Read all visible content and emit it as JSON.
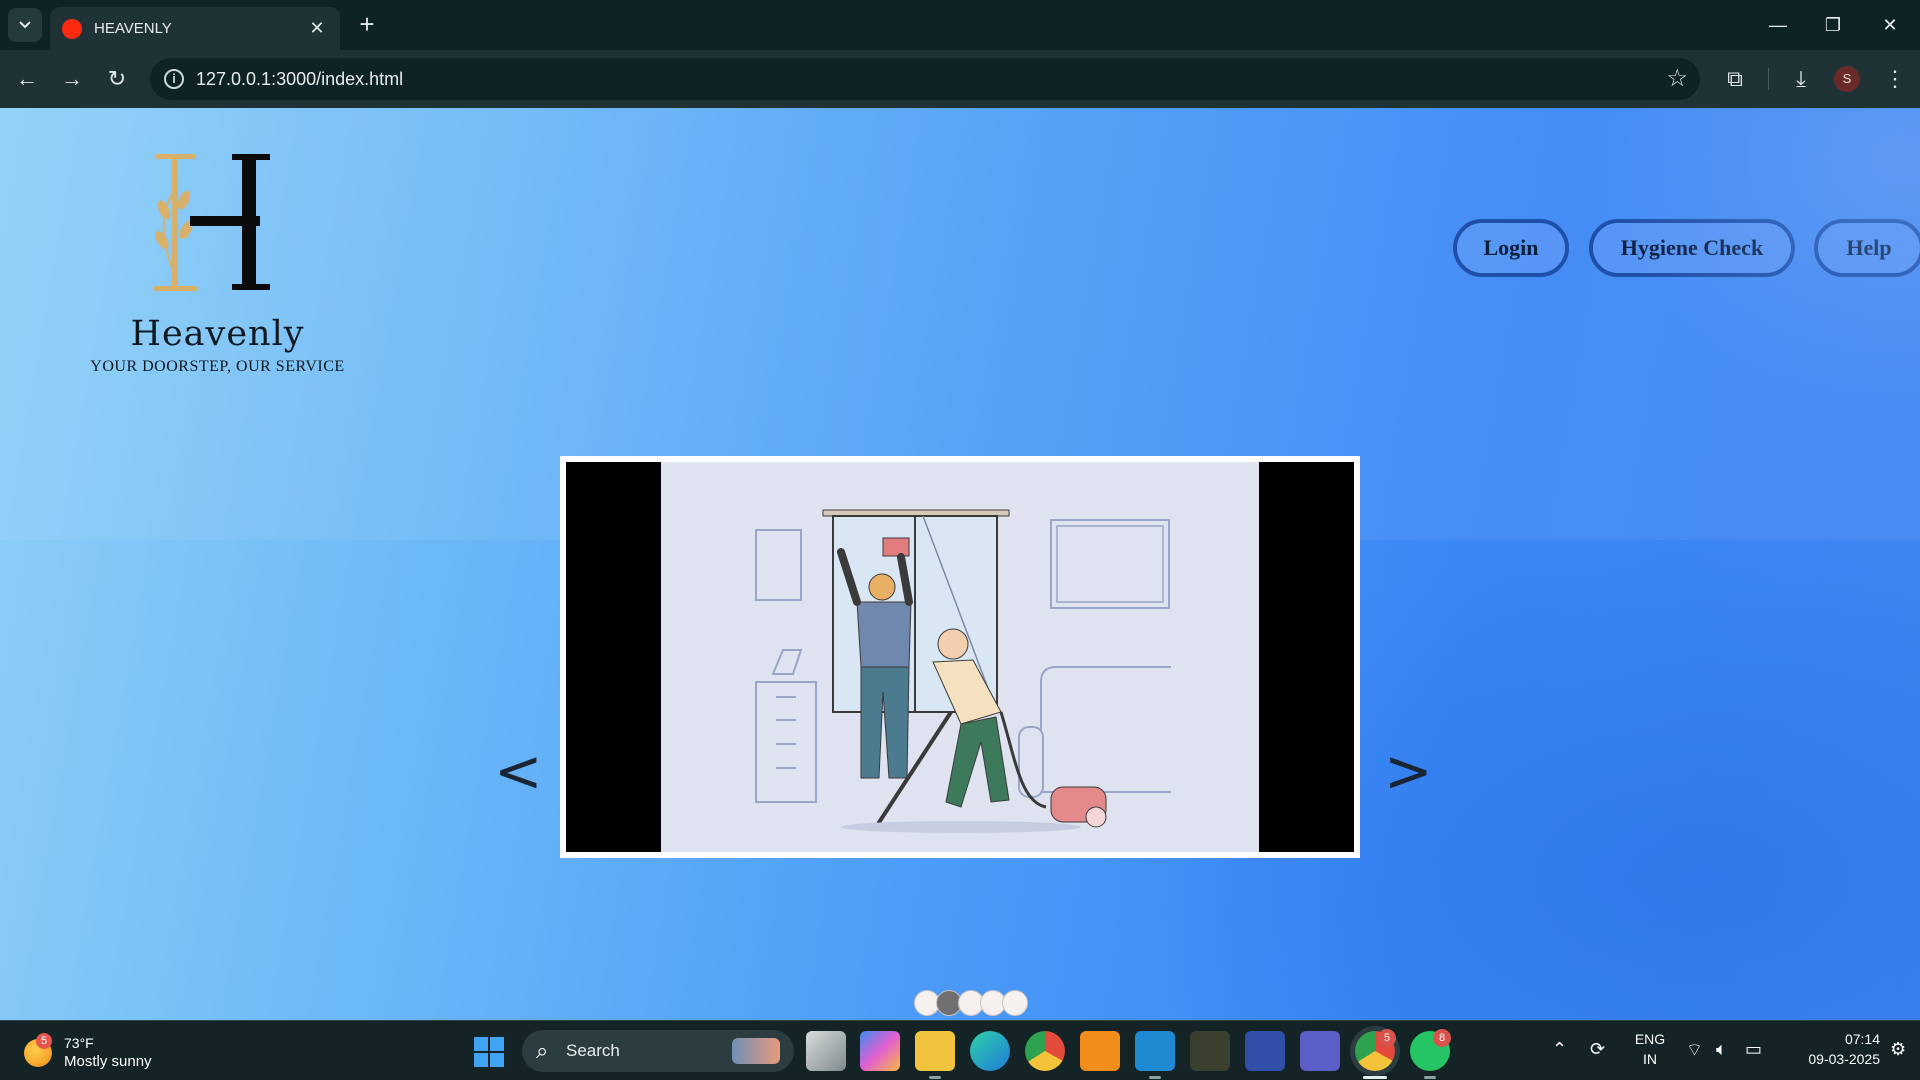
{
  "browser": {
    "tab_title": "HEAVENLY",
    "url": "127.0.0.1:3000/index.html",
    "profile_initial": "S"
  },
  "site": {
    "brand_name": "Heavenly",
    "tagline": "YOUR DOORSTEP, OUR SERVICE",
    "nav": {
      "login": "Login",
      "hygiene_check": "Hygiene Check",
      "help": "Help"
    },
    "carousel": {
      "prev": "<",
      "next": ">",
      "slide_count": 5,
      "active_index": 1
    }
  },
  "taskbar": {
    "weather_badge": "5",
    "temperature": "73°F",
    "condition": "Mostly sunny",
    "search_label": "Search",
    "chrome_badge": "5",
    "whatsapp_badge": "8",
    "language_line1": "ENG",
    "language_line2": "IN",
    "time": "07:14",
    "date": "09-03-2025"
  }
}
